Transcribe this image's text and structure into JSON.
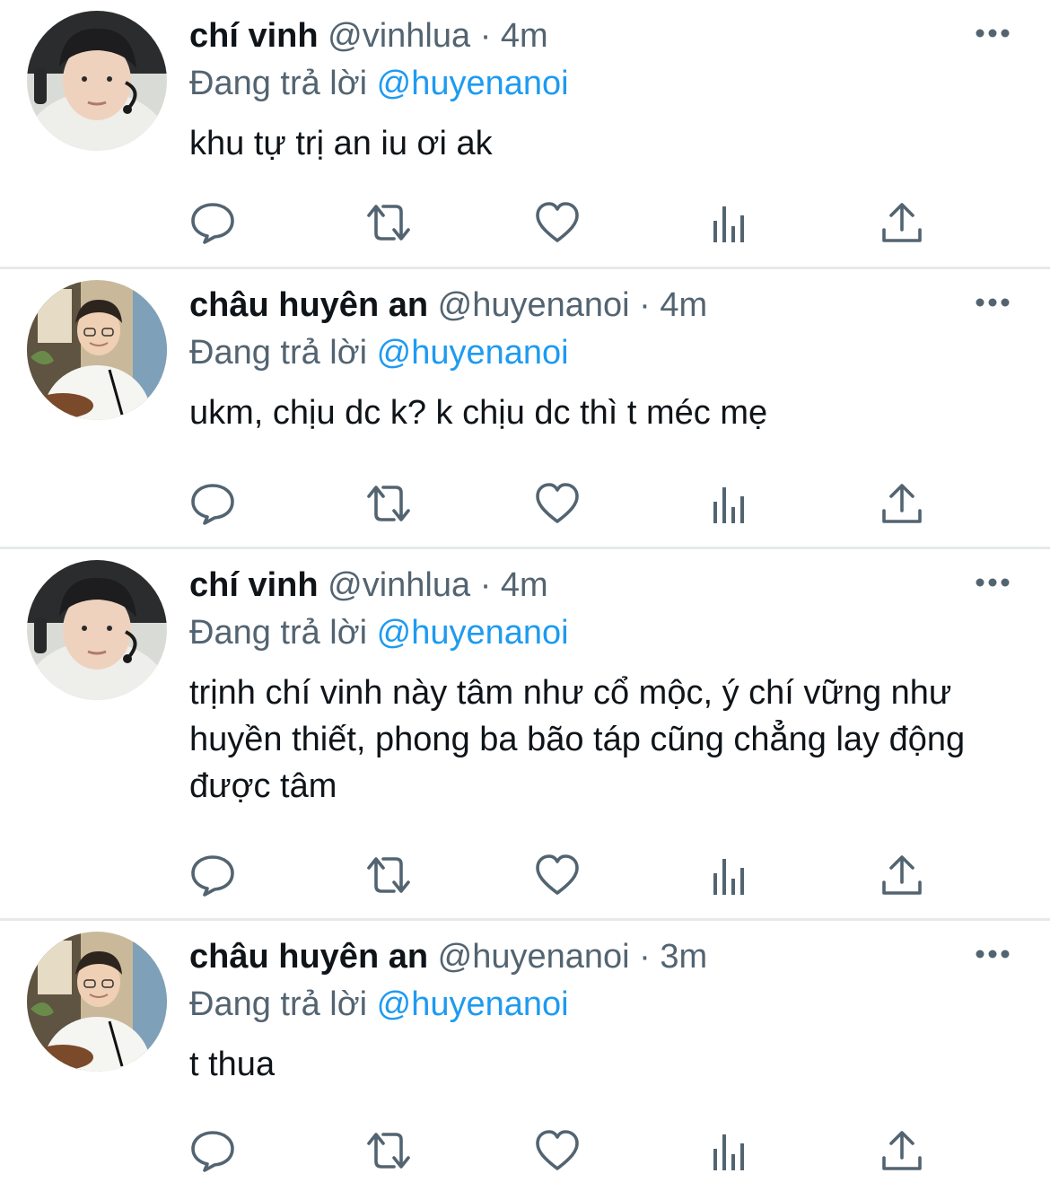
{
  "colors": {
    "text": "#0f1419",
    "secondary": "#536471",
    "mention": "#1d9bf0",
    "icon": "#536471",
    "divider": "#e6e9eb"
  },
  "reply_prefix": "Đang trả lời",
  "separator": "·",
  "tweets": [
    {
      "name": "chí vinh",
      "handle": "@vinhlua",
      "time": "4m",
      "reply_to": "@huyenanoi",
      "text": "khu tự trị an iu ơi ak",
      "avatar": "photo-avatar-vinh"
    },
    {
      "name": "châu huyên an",
      "handle": "@huyenanoi",
      "time": "4m",
      "reply_to": "@huyenanoi",
      "text": "ukm, chịu dc k? k chịu dc thì t méc mẹ",
      "avatar": "photo-avatar-an"
    },
    {
      "name": "chí vinh",
      "handle": "@vinhlua",
      "time": "4m",
      "reply_to": "@huyenanoi",
      "text": "trịnh chí vinh này tâm như cổ mộc, ý chí vững như huyền thiết, phong ba bão táp cũng chẳng lay động được tâm",
      "avatar": "photo-avatar-vinh"
    },
    {
      "name": "châu huyên an",
      "handle": "@huyenanoi",
      "time": "3m",
      "reply_to": "@huyenanoi",
      "text": "t thua",
      "avatar": "photo-avatar-an"
    }
  ],
  "action_icons": [
    "reply-icon",
    "retweet-icon",
    "like-icon",
    "analytics-icon",
    "share-icon"
  ]
}
